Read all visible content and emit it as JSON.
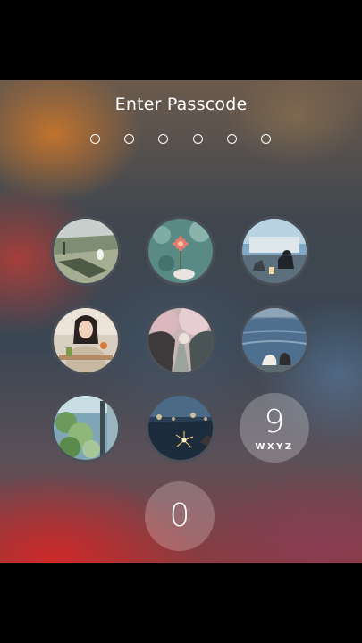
{
  "lock_screen": {
    "title": "Enter Passcode",
    "passcode_dots": 6,
    "keypad": {
      "key_1": {
        "image": "park-grass-with-white-bird"
      },
      "key_2": {
        "image": "pink-flower-bokeh"
      },
      "key_3": {
        "image": "black-cat-by-cafe-window"
      },
      "key_4": {
        "image": "smiling-woman-at-cafe-table"
      },
      "key_5": {
        "image": "cherry-blossom-path"
      },
      "key_6": {
        "image": "two-cats-by-lake"
      },
      "key_7": {
        "image": "green-foliage-window"
      },
      "key_8": {
        "image": "sparkler-at-night-water"
      },
      "key_9": {
        "digit": "9",
        "letters": "WXYZ"
      },
      "key_0": {
        "digit": "0"
      }
    }
  }
}
